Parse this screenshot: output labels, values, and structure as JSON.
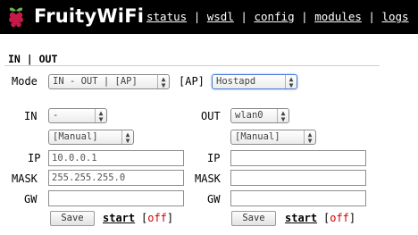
{
  "header": {
    "brand": "FruityWiFi",
    "nav": [
      {
        "label": "status"
      },
      {
        "label": "wsdl"
      },
      {
        "label": "config"
      },
      {
        "label": "modules"
      },
      {
        "label": "logs"
      }
    ],
    "separator": "|"
  },
  "section": {
    "title": "IN | OUT"
  },
  "mode": {
    "label": "Mode",
    "value": "IN - OUT | [AP]",
    "ap_label": "[AP]",
    "ap_value": "Hostapd"
  },
  "in_panel": {
    "label": "IN",
    "interface": "-",
    "config": "[Manual]",
    "ip_label": "IP",
    "ip_value": "10.0.0.1",
    "mask_label": "MASK",
    "mask_value": "255.255.255.0",
    "gw_label": "GW",
    "gw_value": "",
    "save_label": "Save",
    "start_label": "start",
    "status_open": "[",
    "status_value": "off",
    "status_close": "]"
  },
  "out_panel": {
    "label": "OUT",
    "interface": "wlan0",
    "config": "[Manual]",
    "ip_label": "IP",
    "ip_value": "",
    "mask_label": "MASK",
    "mask_value": "",
    "gw_label": "GW",
    "gw_value": "",
    "save_label": "Save",
    "start_label": "start",
    "status_open": "[",
    "status_value": "off",
    "status_close": "]"
  },
  "icons": {
    "logo": "raspberry-icon",
    "select_arrow": "updown-chevron-icon"
  },
  "colors": {
    "header_bg": "#000000",
    "header_text": "#ffffff",
    "status_off": "#d00000",
    "focus_border": "#4a7ad8"
  }
}
